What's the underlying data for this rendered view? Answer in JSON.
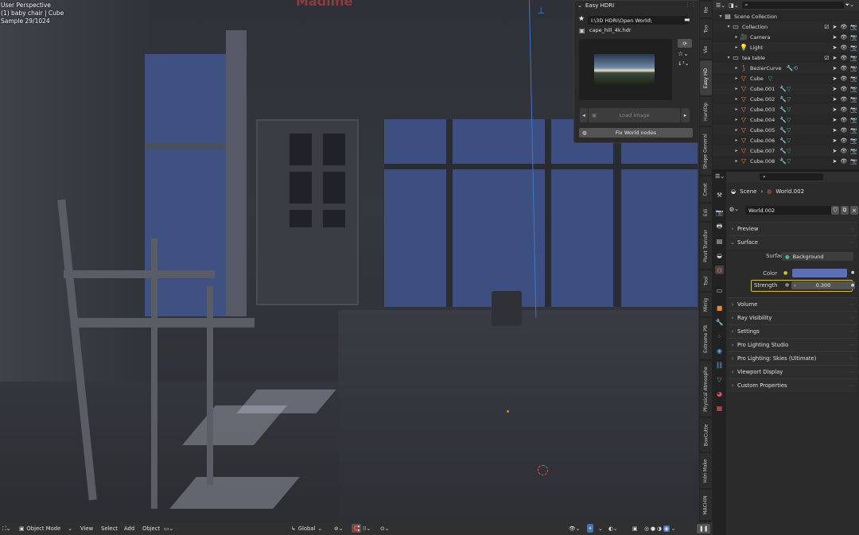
{
  "viewport": {
    "overlay_lines": [
      "User Perspective",
      "(1) baby chair | Cube",
      "Sample 29/1024"
    ],
    "watermark": "Madline"
  },
  "easy_hdri": {
    "title": "Easy HDRI",
    "folder_path": "I:\\3D HDRI\\Open World\\",
    "hdr_file": "cape_hill_4k.hdr",
    "load_image_label": "Load image",
    "fix_world_label": "Fix World nodes"
  },
  "side_tabs": [
    "Ite",
    "Too",
    "Vie",
    "Easy HD",
    "HardOp",
    "Shape General",
    "Creat",
    "Edi",
    "Pivot Transfor",
    "Tool",
    "Mirrig",
    "Extreme PB",
    "Physical Atmosphe",
    "BoxCutte",
    "Hdri Make",
    "MACHIN"
  ],
  "outliner": {
    "search_placeholder": "",
    "rows": [
      {
        "label": "Scene Collection",
        "indent": 0,
        "type": "scene"
      },
      {
        "label": "Collection",
        "indent": 1,
        "type": "collection"
      },
      {
        "label": "Camera",
        "indent": 2,
        "type": "camera"
      },
      {
        "label": "Light",
        "indent": 2,
        "type": "light"
      },
      {
        "label": "tea table",
        "indent": 1,
        "type": "collection"
      },
      {
        "label": "BezierCurve",
        "indent": 2,
        "type": "curve"
      },
      {
        "label": "Cube",
        "indent": 2,
        "type": "mesh"
      },
      {
        "label": "Cube.001",
        "indent": 2,
        "type": "mesh"
      },
      {
        "label": "Cube.002",
        "indent": 2,
        "type": "mesh"
      },
      {
        "label": "Cube.003",
        "indent": 2,
        "type": "mesh"
      },
      {
        "label": "Cube.004",
        "indent": 2,
        "type": "mesh"
      },
      {
        "label": "Cube.005",
        "indent": 2,
        "type": "mesh"
      },
      {
        "label": "Cube.006",
        "indent": 2,
        "type": "mesh"
      },
      {
        "label": "Cube.007",
        "indent": 2,
        "type": "mesh"
      },
      {
        "label": "Cube.008",
        "indent": 2,
        "type": "mesh"
      }
    ]
  },
  "properties": {
    "breadcrumb_scene": "Scene",
    "breadcrumb_world": "World.002",
    "world_name": "World.002",
    "sections": [
      "Preview",
      "Surface",
      "Volume",
      "Ray Visibility",
      "Settings",
      "Pro Lighting Studio",
      "Pro Lighting: Skies (Ultimate)",
      "Viewport Display",
      "Custom Properties"
    ],
    "surface_label": "Surface",
    "surface_value": "Background",
    "color_label": "Color",
    "color_value": "#5b6fb3",
    "strength_label": "Strength",
    "strength_value": "0.300"
  },
  "bottom_bar": {
    "mode": "Object Mode",
    "menus": [
      "View",
      "Select",
      "Add",
      "Object"
    ],
    "orientation": "Global"
  },
  "colors": {
    "accent_orange": "#e08b3b",
    "selection_yellow": "#d8c13a",
    "mesh_green": "#3dbd8c"
  }
}
